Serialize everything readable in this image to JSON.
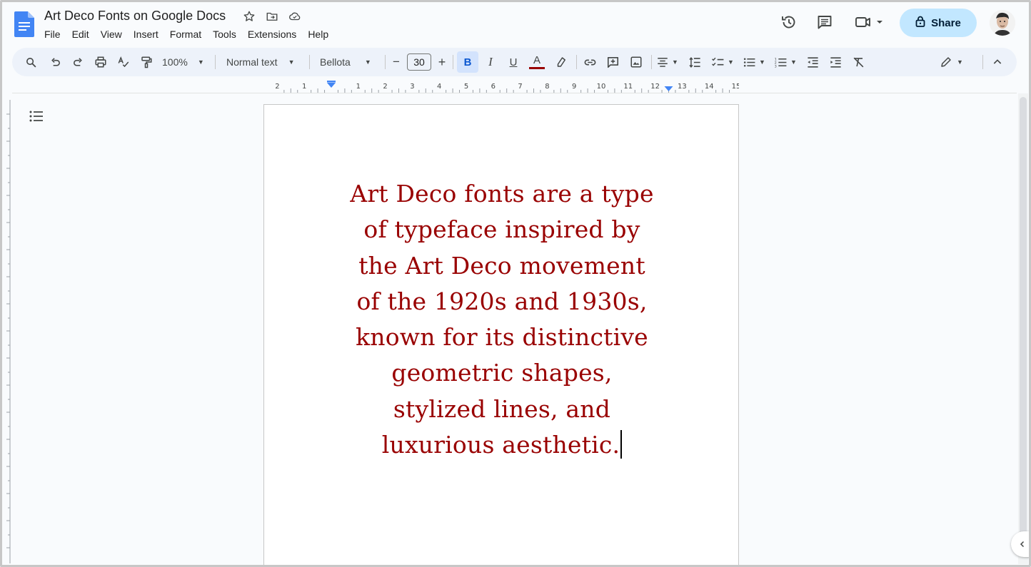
{
  "app": {
    "title": "Art Deco Fonts on Google Docs"
  },
  "menu": [
    "File",
    "Edit",
    "View",
    "Insert",
    "Format",
    "Tools",
    "Extensions",
    "Help"
  ],
  "header": {
    "share_label": "Share"
  },
  "toolbar": {
    "zoom": "100%",
    "style": "Normal text",
    "font": "Bellota",
    "font_size": "30",
    "minus": "−",
    "plus": "+",
    "bold": "B",
    "italic": "I",
    "underline": "U",
    "text_color_letter": "A",
    "text_color": "#990000"
  },
  "ruler": {
    "labels": [
      "2",
      "1",
      "",
      "1",
      "2",
      "3",
      "4",
      "5",
      "6",
      "7",
      "8",
      "9",
      "10",
      "11",
      "12",
      "13",
      "14",
      "15"
    ]
  },
  "document": {
    "text_color": "#990000",
    "lines": [
      "Art Deco fonts are a type",
      "of typeface inspired by",
      "the Art Deco movement",
      "of the 1920s and 1930s,",
      "known for its distinctive",
      "geometric shapes,",
      "stylized lines, and",
      "luxurious aesthetic."
    ]
  },
  "colors": {
    "accent": "#0b57d0",
    "share_bg": "#c2e7ff",
    "toolbar_bg": "#edf2fa",
    "docs_blue": "#4285f4"
  }
}
